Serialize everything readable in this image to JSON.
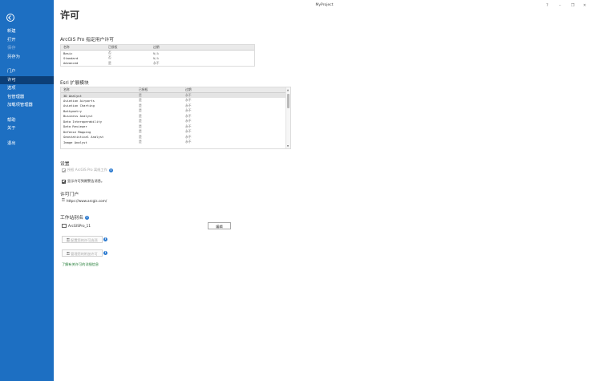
{
  "window": {
    "title": "MyProject",
    "help": "?",
    "minimize": "–",
    "restore": "❐",
    "close": "✕"
  },
  "sidebar": {
    "items": [
      {
        "label": "新建",
        "state": "normal"
      },
      {
        "label": "打开",
        "state": "normal"
      },
      {
        "label": "保存",
        "state": "disabled"
      },
      {
        "label": "另存为",
        "state": "normal"
      },
      {
        "label": "门户",
        "state": "normal"
      },
      {
        "label": "许可",
        "state": "active"
      },
      {
        "label": "选项",
        "state": "normal"
      },
      {
        "label": "包管理器",
        "state": "normal"
      },
      {
        "label": "加载项管理器",
        "state": "normal"
      },
      {
        "label": "帮助",
        "state": "normal"
      },
      {
        "label": "关于",
        "state": "normal"
      },
      {
        "label": "退出",
        "state": "normal"
      }
    ]
  },
  "page": {
    "title": "许可"
  },
  "named_user": {
    "title": "ArcGIS Pro 指定用户许可",
    "columns": [
      "名称",
      "已授权",
      "过期"
    ],
    "rows": [
      [
        "Basic",
        "否",
        "N/A"
      ],
      [
        "Standard",
        "否",
        "N/A"
      ],
      [
        "Advanced",
        "是",
        "永不"
      ]
    ]
  },
  "extensions": {
    "title": "Esri 扩展模块",
    "columns": [
      "名称",
      "已授权",
      "过期"
    ],
    "rows": [
      [
        "3D Analyst",
        "是",
        "永不"
      ],
      [
        "Aviation Airports",
        "是",
        "永不"
      ],
      [
        "Aviation Charting",
        "是",
        "永不"
      ],
      [
        "Bathymetry",
        "是",
        "永不"
      ],
      [
        "Business Analyst",
        "是",
        "永不"
      ],
      [
        "Data Interoperability",
        "是",
        "永不"
      ],
      [
        "Data Reviewer",
        "是",
        "永不"
      ],
      [
        "Defense Mapping",
        "是",
        "永不"
      ],
      [
        "Geostatistical Analyst",
        "是",
        "永不"
      ],
      [
        "Image Analyst",
        "是",
        "永不"
      ]
    ]
  },
  "settings": {
    "title": "设置",
    "option1": "授权 ArcGIS Pro 离线工作",
    "option2": "显示许可到期警告消息。"
  },
  "portal": {
    "title": "许可门户",
    "url": "https://www.arcgis.com/"
  },
  "workstation": {
    "title": "工作站别名",
    "name": "ArcGISPro_11",
    "edit_label": "编辑"
  },
  "actions": {
    "configure_label": "配置您的许可选项",
    "manage_label": "管理您的附加许可",
    "learn_more": "了解有关许可的详细信息"
  }
}
